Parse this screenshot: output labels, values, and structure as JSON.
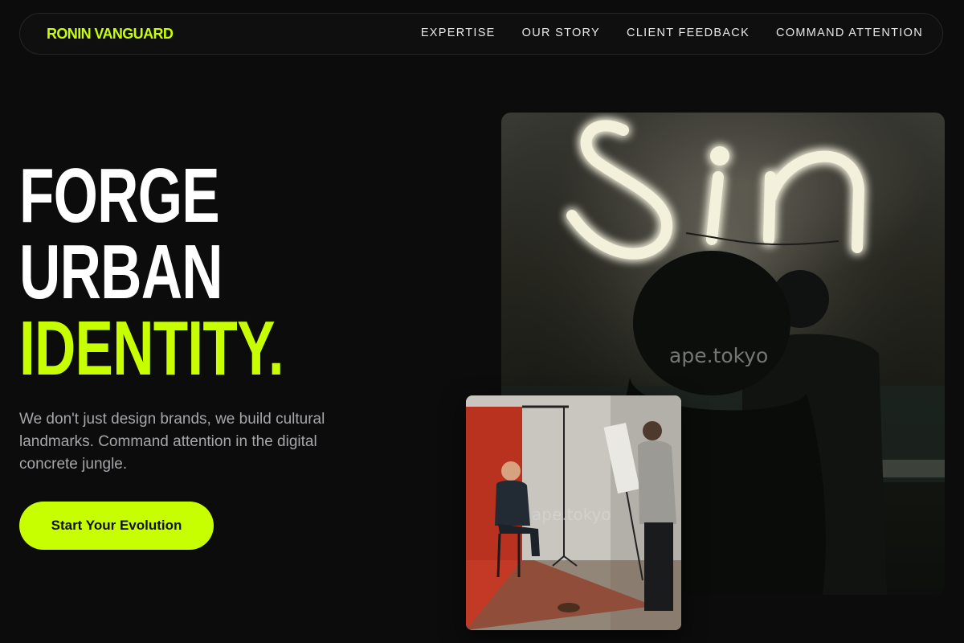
{
  "brand": {
    "name": "RONIN VANGUARD"
  },
  "nav": {
    "links": [
      {
        "label": "EXPERTISE"
      },
      {
        "label": "OUR STORY"
      },
      {
        "label": "CLIENT FEEDBACK"
      },
      {
        "label": "COMMAND ATTENTION"
      }
    ]
  },
  "hero": {
    "headline_line1": "FORGE",
    "headline_line2": "URBAN",
    "headline_line3": "IDENTITY.",
    "subcopy": "We don't just design brands, we build cultural landmarks. Command attention in the digital concrete jungle.",
    "cta_label": "Start Your Evolution"
  },
  "images": {
    "main": {
      "sign_text": "Sin",
      "watermark": "ape.tokyo"
    },
    "inset": {
      "watermark": "ape.tokyo"
    }
  },
  "colors": {
    "accent": "#c8ff00",
    "background": "#0c0c0c",
    "text_primary": "#ffffff",
    "text_muted": "#a6a6ab"
  }
}
